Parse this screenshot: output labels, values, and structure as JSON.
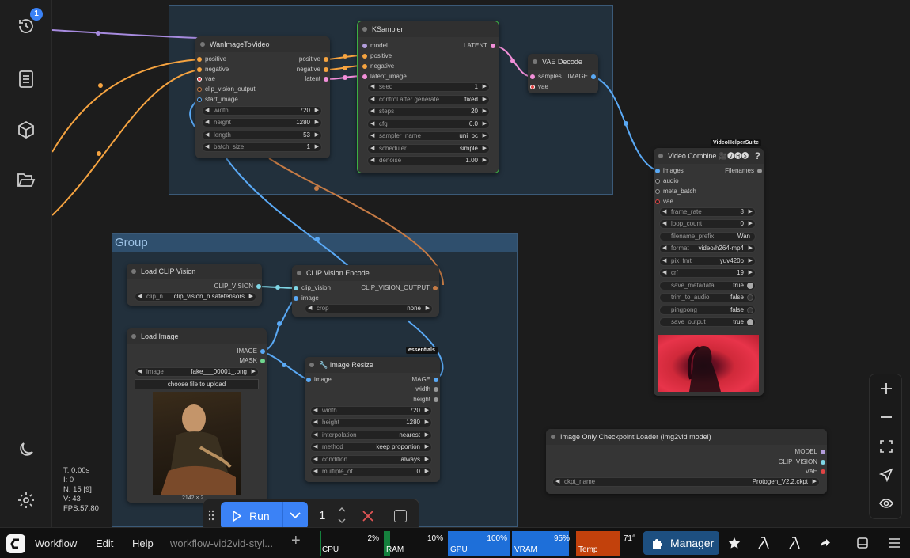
{
  "sidebar": {
    "history_badge": "1"
  },
  "groups": {
    "group2_title": "Group"
  },
  "nodes": {
    "wan": {
      "title": "WanImageToVideo",
      "inputs": [
        "positive",
        "negative",
        "vae",
        "clip_vision_output",
        "start_image"
      ],
      "outputs": [
        "positive",
        "negative",
        "latent"
      ],
      "widgets": [
        {
          "label": "width",
          "value": "720"
        },
        {
          "label": "height",
          "value": "1280"
        },
        {
          "label": "length",
          "value": "53"
        },
        {
          "label": "batch_size",
          "value": "1"
        }
      ]
    },
    "ksampler": {
      "title": "KSampler",
      "inputs": [
        "model",
        "positive",
        "negative",
        "latent_image"
      ],
      "outputs": [
        "LATENT"
      ],
      "widgets": [
        {
          "label": "seed",
          "value": "1"
        },
        {
          "label": "control after generate",
          "value": "fixed"
        },
        {
          "label": "steps",
          "value": "20"
        },
        {
          "label": "cfg",
          "value": "6.0"
        },
        {
          "label": "sampler_name",
          "value": "uni_pc"
        },
        {
          "label": "scheduler",
          "value": "simple"
        },
        {
          "label": "denoise",
          "value": "1.00"
        }
      ]
    },
    "vae_decode": {
      "title": "VAE Decode",
      "inputs": [
        "samples",
        "vae"
      ],
      "outputs": [
        "IMAGE"
      ]
    },
    "video_combine": {
      "title": "Video Combine 🎥🅥🅗🅢",
      "tag": "VideoHelperSuite",
      "help": "?",
      "inputs": [
        "images",
        "audio",
        "meta_batch",
        "vae"
      ],
      "outputs": [
        "Filenames"
      ],
      "widgets": [
        {
          "label": "frame_rate",
          "value": "8",
          "kind": "num"
        },
        {
          "label": "loop_count",
          "value": "0",
          "kind": "num"
        },
        {
          "label": "filename_prefix",
          "value": "Wan",
          "kind": "text"
        },
        {
          "label": "format",
          "value": "video/h264-mp4",
          "kind": "num"
        },
        {
          "label": "pix_fmt",
          "value": "yuv420p",
          "kind": "num"
        },
        {
          "label": "crf",
          "value": "19",
          "kind": "num"
        },
        {
          "label": "save_metadata",
          "value": "true",
          "kind": "toggle"
        },
        {
          "label": "trim_to_audio",
          "value": "false",
          "kind": "toggle"
        },
        {
          "label": "pingpong",
          "value": "false",
          "kind": "toggle"
        },
        {
          "label": "save_output",
          "value": "true",
          "kind": "toggle"
        }
      ]
    },
    "load_clip_vision": {
      "title": "Load CLIP Vision",
      "outputs": [
        "CLIP_VISION"
      ],
      "widget_label": "clip_n...",
      "widget_value": "clip_vision_h.safetensors"
    },
    "clip_vision_encode": {
      "title": "CLIP Vision Encode",
      "inputs": [
        "clip_vision",
        "image"
      ],
      "outputs": [
        "CLIP_VISION_OUTPUT"
      ],
      "widget_label": "crop",
      "widget_value": "none"
    },
    "load_image": {
      "title": "Load Image",
      "outputs": [
        "IMAGE",
        "MASK"
      ],
      "widget_label": "image",
      "widget_value": "fake___00001_.png",
      "upload_label": "choose file to upload",
      "image_caption": "2142 × 2..."
    },
    "image_resize": {
      "title": "🔧 Image Resize",
      "tag": "essentials",
      "inputs": [
        "image"
      ],
      "outputs": [
        "IMAGE",
        "width",
        "height"
      ],
      "widgets": [
        {
          "label": "width",
          "value": "720"
        },
        {
          "label": "height",
          "value": "1280"
        },
        {
          "label": "interpolation",
          "value": "nearest"
        },
        {
          "label": "method",
          "value": "keep proportion"
        },
        {
          "label": "condition",
          "value": "always"
        },
        {
          "label": "multiple_of",
          "value": "0"
        }
      ]
    },
    "checkpoint": {
      "title": "Image Only Checkpoint Loader (img2vid model)",
      "outputs": [
        "MODEL",
        "CLIP_VISION",
        "VAE"
      ],
      "widget_label": "ckpt_name",
      "widget_value": "Protogen_V2.2.ckpt"
    }
  },
  "stats": [
    "T: 0.00s",
    "I: 0",
    "N: 15 [9]",
    "V: 43",
    "FPS:57.80"
  ],
  "runbar": {
    "run_label": "Run",
    "batch_count": "1"
  },
  "topbar": {
    "menus": [
      "Workflow",
      "Edit",
      "Help"
    ],
    "workflow_tab": "workflow-vid2vid-styl...",
    "monitors": [
      {
        "label": "CPU",
        "value": "2%",
        "fraction": 0.02,
        "color": "#15803d"
      },
      {
        "label": "RAM",
        "value": "10%",
        "fraction": 0.1,
        "color": "#15803d"
      },
      {
        "label": "GPU",
        "value": "100%",
        "fraction": 1.0,
        "color": "#1e6fd9"
      },
      {
        "label": "VRAM",
        "value": "95%",
        "fraction": 0.95,
        "color": "#1e6fd9"
      },
      {
        "label": "Temp",
        "value": "71°",
        "fraction": 0.71,
        "color": "#c2410c"
      }
    ],
    "manager_label": "Manager"
  }
}
